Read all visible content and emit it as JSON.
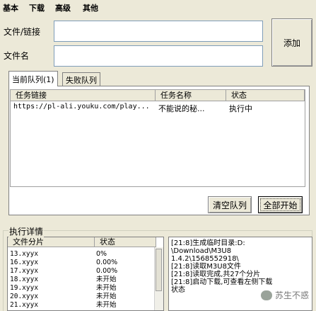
{
  "menu": [
    "基本",
    "下载",
    "高级",
    "其他"
  ],
  "form": {
    "file_label": "文件/链接",
    "name_label": "文件名",
    "file_value": "",
    "name_value": "",
    "add_button": "添加"
  },
  "tabs": [
    "当前队列(1)",
    "失败队列"
  ],
  "queue": {
    "columns": [
      "任务链接",
      "任务名称",
      "状态"
    ],
    "rows": [
      {
        "link": "https://pl-ali.youku.com/play...",
        "name": "不能说的秘...",
        "status": "执行中"
      }
    ],
    "clear_button": "清空队列",
    "start_all_button": "全部开始"
  },
  "details": {
    "title": "执行详情",
    "columns": [
      "文件分片",
      "状态"
    ],
    "rows": [
      {
        "file": "13.xyyx",
        "status": "0%"
      },
      {
        "file": "16.xyyx",
        "status": "0.00%"
      },
      {
        "file": "17.xyyx",
        "status": "0.00%"
      },
      {
        "file": "18.xyyx",
        "status": "未开始"
      },
      {
        "file": "19.xyyx",
        "status": "未开始"
      },
      {
        "file": "20.xyyx",
        "status": "未开始"
      },
      {
        "file": "21.xyyx",
        "status": "未开始"
      }
    ],
    "log": [
      "[21:8]生成临时目录:D:",
      "\\Download\\M3U8",
      "1.4.2\\1568552918\\",
      "[21:8]读取M3U8文件",
      "[21:8]读取完成,共27个分片",
      "[21:8]启动下载,可查看左侧下载",
      "状态"
    ]
  },
  "watermark": "苏生不惑"
}
